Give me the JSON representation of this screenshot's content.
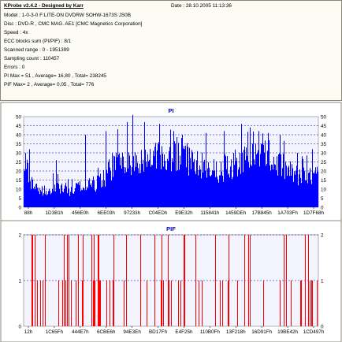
{
  "header": {
    "title": "KProbe v2.4.2 - Designed by Karr",
    "date": "Date : 28.10.2005 11:13:36"
  },
  "info_lines": [
    "Model : 1-0-3-0 F:LITE-ON DVDRW SOHW-1673S JS0B",
    "Disc : DVD-R , CMC MAG. AE1 [CMC Magnetics Corporation]",
    "Speed : 4x",
    "ECC blocks sum (PI/PIF) : 8/1",
    "Scanned range : 0 - 1951399",
    "Sampling count : 110457",
    "Errors : 0",
    "PI Max = 51 , Average= 16,80 , Total= 238245",
    "PIF Max= 2 , Average= 0,05 , Total= 776"
  ],
  "colors": {
    "pi_series": "#0000ff",
    "pif_series": "#ff0000",
    "pi_plot_bg": "#f4f4ff",
    "pif_plot_bg": "#f4f4ff",
    "grid": "#0000a0",
    "title_color": "#0000c0"
  },
  "chart_data": [
    {
      "type": "bar",
      "title": "PI",
      "ylim": [
        0,
        50
      ],
      "yticks": [
        0,
        5,
        10,
        15,
        20,
        25,
        30,
        35,
        40,
        45,
        50
      ],
      "x_tick_labels": [
        "88h",
        "1D3B1h",
        "456E0h",
        "6EE03h",
        "97233h",
        "C04EDh",
        "E9E32h",
        "115841h",
        "1459DEh",
        "17B845h",
        "1A703Fh",
        "1D7F68h"
      ],
      "grid": true,
      "max": 51,
      "average": 16.8,
      "profile": [
        [
          0,
          36
        ],
        [
          1,
          24
        ],
        [
          3,
          14
        ],
        [
          5,
          12
        ],
        [
          8,
          10
        ],
        [
          12,
          12
        ],
        [
          16,
          10
        ],
        [
          20,
          14
        ],
        [
          24,
          15
        ],
        [
          27,
          18
        ],
        [
          30,
          26
        ],
        [
          33,
          27
        ],
        [
          36,
          29
        ],
        [
          40,
          31
        ],
        [
          44,
          33
        ],
        [
          48,
          30
        ],
        [
          50,
          33
        ],
        [
          53,
          34
        ],
        [
          56,
          31
        ],
        [
          60,
          27
        ],
        [
          63,
          24
        ],
        [
          66,
          23
        ],
        [
          70,
          27
        ],
        [
          73,
          31
        ],
        [
          76,
          33
        ],
        [
          79,
          32
        ],
        [
          82,
          34
        ],
        [
          85,
          30
        ],
        [
          88,
          26
        ],
        [
          91,
          22
        ],
        [
          94,
          20
        ],
        [
          97,
          19
        ],
        [
          100,
          20
        ]
      ],
      "spikes": [
        [
          2,
          32
        ],
        [
          11,
          26
        ],
        [
          21,
          40
        ],
        [
          28,
          42
        ],
        [
          32,
          43
        ],
        [
          35,
          47
        ],
        [
          37,
          51
        ],
        [
          41,
          47
        ],
        [
          46,
          46
        ],
        [
          51,
          42
        ],
        [
          54,
          40
        ],
        [
          62,
          41
        ],
        [
          68,
          42
        ],
        [
          74,
          46
        ],
        [
          77,
          44
        ],
        [
          80,
          42
        ],
        [
          83,
          41
        ],
        [
          87,
          40
        ],
        [
          93,
          30
        ],
        [
          98,
          32
        ]
      ]
    },
    {
      "type": "bar",
      "title": "PIF",
      "ylim": [
        0,
        2
      ],
      "yticks": [
        0,
        1,
        2
      ],
      "x_tick_labels": [
        "12h",
        "1C65Fh",
        "444E7h",
        "6CBE6h",
        "94E3Eh",
        "BD17Fh",
        "E4F25h",
        "110B0Fh",
        "13F218h",
        "16D91Fh",
        "19BE42h",
        "1CD497h"
      ],
      "grid": true,
      "max": 2,
      "average": 0.05
    }
  ]
}
